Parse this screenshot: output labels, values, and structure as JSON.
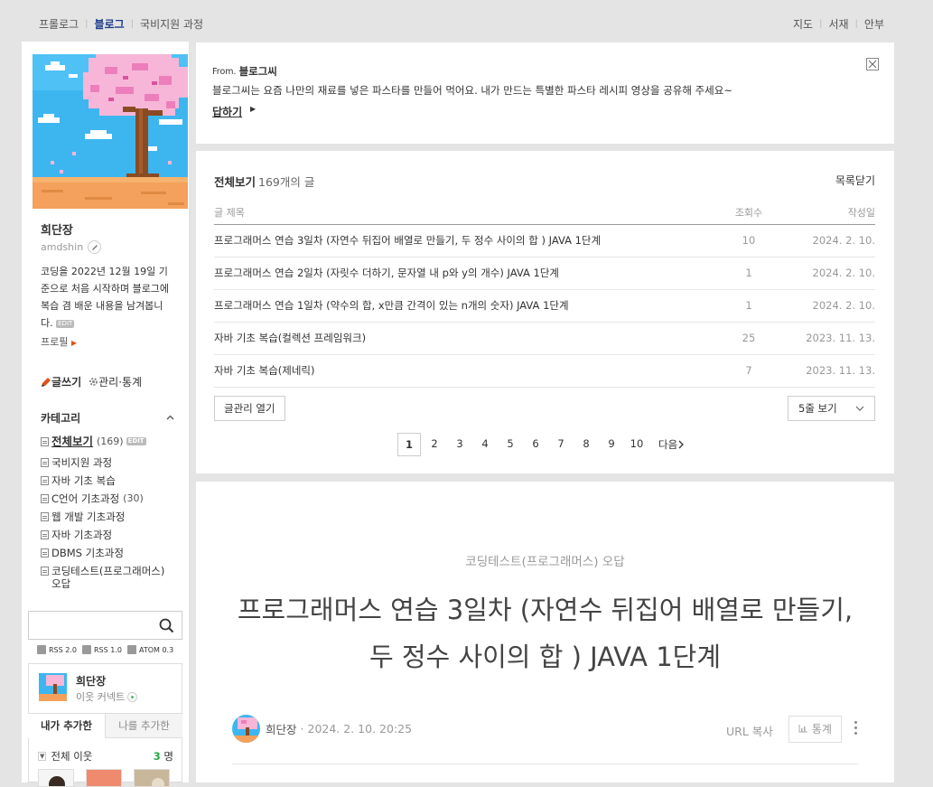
{
  "topnav": {
    "left": [
      "프롤로그",
      "블로그",
      "국비지원 과정"
    ],
    "active_index": 1,
    "right": [
      "지도",
      "서재",
      "안부"
    ]
  },
  "sidebar": {
    "nickname": "희단장",
    "blog_id": "amdshin",
    "intro": "코딩을 2022년 12월 19일 기준으로 처음 시작하며 블로그에 복습 겸 배운 내용을 남겨봅니다.",
    "edit_label": "EDIT",
    "profile_link": "프로필",
    "write_label": "글쓰기",
    "manage_label": "관리·통계",
    "category_title": "카테고리",
    "categories": {
      "all_label": "전체보기",
      "all_count": "(169)",
      "items": [
        {
          "label": "국비지원 과정",
          "count": ""
        },
        {
          "label": "자바 기초 복습",
          "count": ""
        },
        {
          "label": "C언어 기초과정",
          "count": "(30)"
        },
        {
          "label": "웹 개발 기초과정",
          "count": ""
        },
        {
          "label": "자바 기초과정",
          "count": ""
        },
        {
          "label": "DBMS 기초과정",
          "count": ""
        },
        {
          "label": "코딩테스트(프로그래머스) 오답",
          "count": ""
        }
      ]
    },
    "search_placeholder": "",
    "feeds": [
      "RSS 2.0",
      "RSS 1.0",
      "ATOM 0.3"
    ],
    "neighbor": {
      "name": "희단장",
      "connect_label": "이웃 커넥트",
      "tab_mine": "내가 추가한",
      "tab_others": "나를 추가한",
      "all_label": "전체 이웃",
      "all_count": "3",
      "all_unit": "명"
    }
  },
  "notice": {
    "from_label": "From.",
    "from_name": "블로그씨",
    "message": "블로그씨는 요즘 나만의 재료를 넣은 파스타를 만들어 먹어요. 내가 만드는 특별한 파스타 레시피 영상을 공유해 주세요~",
    "reply_label": "답하기"
  },
  "post_list": {
    "title": "전체보기",
    "count": "169개의 글",
    "close_label": "목록닫기",
    "headers": {
      "title": "글 제목",
      "views": "조회수",
      "date": "작성일"
    },
    "rows": [
      {
        "title": "프로그래머스 연습 3일차 (자연수 뒤집어 배열로 만들기, 두 정수 사이의 합 ) JAVA 1단계",
        "views": "10",
        "date": "2024. 2. 10."
      },
      {
        "title": "프로그래머스 연습 2일차 (자릿수 더하기, 문자열 내 p와 y의 개수) JAVA 1단계",
        "views": "1",
        "date": "2024. 2. 10."
      },
      {
        "title": "프로그래머스 연습 1일차 (약수의 합, x만큼 간격이 있는 n개의 숫자) JAVA 1단계",
        "views": "1",
        "date": "2024. 2. 10."
      },
      {
        "title": "자바 기초 복습(컬렉션 프레임워크)",
        "views": "25",
        "date": "2023. 11. 13."
      },
      {
        "title": "자바 기초 복습(제네릭)",
        "views": "7",
        "date": "2023. 11. 13."
      }
    ],
    "manage_label": "글관리 열기",
    "lines_label": "5줄 보기",
    "pages": [
      "1",
      "2",
      "3",
      "4",
      "5",
      "6",
      "7",
      "8",
      "9",
      "10"
    ],
    "current_page": "1",
    "next_label": "다음"
  },
  "post": {
    "category": "코딩테스트(프로그래머스) 오답",
    "title": "프로그래머스 연습 3일차 (자연수 뒤집어 배열로 만들기, 두 정수 사이의 합 ) JAVA 1단계",
    "author": "희단장",
    "datetime": "2024. 2. 10. 20:25",
    "url_copy_label": "URL 복사",
    "stats_label": "통계"
  },
  "colors": {
    "background": "#e4e4e4",
    "active_nav": "#1c3d8c",
    "accent_arrow": "#e0531a",
    "neighbor_count": "#28a745"
  }
}
